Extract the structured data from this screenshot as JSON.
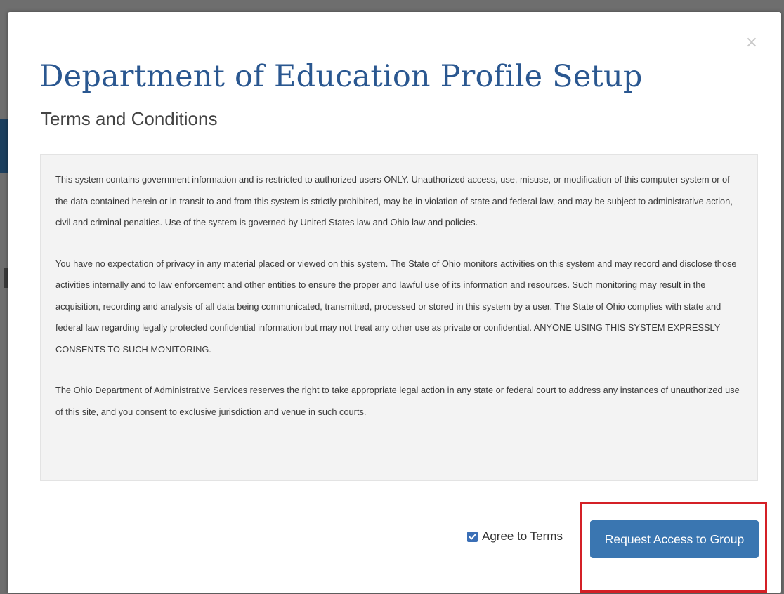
{
  "modal": {
    "title": "Department of Education Profile Setup",
    "subtitle": "Terms and Conditions",
    "close_icon": "close-icon",
    "close_glyph": "×"
  },
  "terms": {
    "paragraphs": [
      "This system contains government information and is restricted to authorized users ONLY. Unauthorized access, use, misuse, or modification of this computer system or of the data contained herein or in transit to and from this system is strictly prohibited, may be in violation of state and federal law, and may be subject to administrative action, civil and criminal penalties. Use of the system is governed by United States law and Ohio law and policies.",
      "You have no expectation of privacy in any material placed or viewed on this system. The State of Ohio monitors activities on this system and may record and disclose those activities internally and to law enforcement and other entities to ensure the proper and lawful use of its information and resources. Such monitoring may result in the acquisition, recording and analysis of all data being communicated, transmitted, processed or stored in this system by a user. The State of Ohio complies with state and federal law regarding legally protected confidential information but may not treat any other use as private or confidential. ANYONE USING THIS SYSTEM EXPRESSLY CONSENTS TO SUCH MONITORING.",
      "The Ohio Department of Administrative Services reserves the right to take appropriate legal action in any state or federal court to address any instances of unauthorized use of this site, and you consent to exclusive jurisdiction and venue in such courts."
    ]
  },
  "footer": {
    "agree_label": "Agree to Terms",
    "agree_checked": true,
    "request_button_label": "Request Access to Group"
  },
  "colors": {
    "title": "#2a5790",
    "button": "#3a76b1",
    "checkbox": "#3b6fb6",
    "highlight": "#d42026",
    "terms_bg": "#f3f3f3"
  }
}
